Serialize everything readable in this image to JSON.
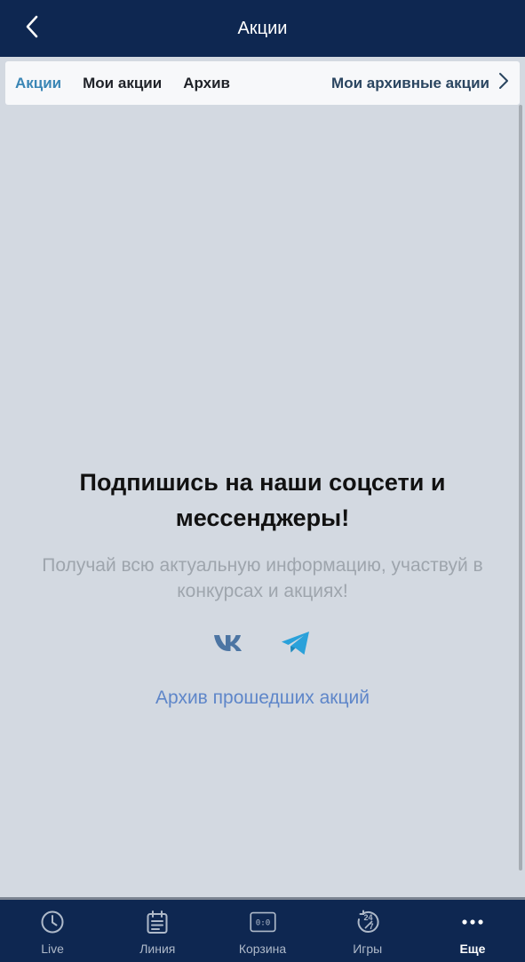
{
  "header": {
    "title": "Акции",
    "back_icon": "chevron-left-icon"
  },
  "tabs": [
    {
      "label": "Акции",
      "active": true
    },
    {
      "label": "Мои акции",
      "active": false
    },
    {
      "label": "Архив",
      "active": false
    }
  ],
  "tabs_right": {
    "label": "Мои архивные акции",
    "icon": "chevron-right-icon"
  },
  "main": {
    "headline": "Подпишись на наши соцсети и мессенджеры!",
    "subtitle": "Получай всю актуальную информацию, участвуй в конкурсах и акциях!",
    "socials": [
      "vk-icon",
      "telegram-icon"
    ],
    "archive_link": "Архив прошедших акций"
  },
  "bottom_nav": [
    {
      "label": "Live",
      "icon": "clock-icon",
      "active": false
    },
    {
      "label": "Линия",
      "icon": "calendar-icon",
      "active": false
    },
    {
      "label": "Корзина",
      "icon": "scoreboard-icon",
      "active": false
    },
    {
      "label": "Игры",
      "icon": "games-24-7-icon",
      "active": false
    },
    {
      "label": "Еще",
      "icon": "more-dots-icon",
      "active": true
    }
  ],
  "colors": {
    "header_bg": "#0e2751",
    "page_bg": "#d3d9e1",
    "accent": "#3a86b5",
    "link": "#5e86c9",
    "vk": "#4c75a3",
    "telegram": "#2aa1da"
  }
}
